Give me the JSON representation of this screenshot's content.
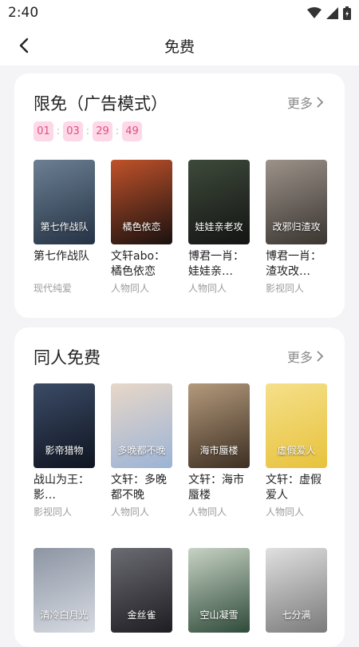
{
  "status": {
    "time": "2:40"
  },
  "header": {
    "title": "免费"
  },
  "section1": {
    "title": "限免（广告模式）",
    "more": "更多",
    "timer": [
      "01",
      "03",
      "29",
      "49"
    ],
    "books": [
      {
        "title": "第七作战队",
        "category": "现代纯爱",
        "cover_text": "第七作战队",
        "color1": "#243244",
        "color2": "#6c7f93"
      },
      {
        "title": "文轩abo：橘色依恋",
        "category": "人物同人",
        "cover_text": "橘色依恋",
        "color1": "#1a1110",
        "color2": "#c0522a"
      },
      {
        "title": "博君一肖：娃娃亲…",
        "category": "人物同人",
        "cover_text": "娃娃亲老攻",
        "color1": "#141414",
        "color2": "#3d4a3a"
      },
      {
        "title": "博君一肖：渣攻改…",
        "category": "影视同人",
        "cover_text": "改邪归渣攻",
        "color1": "#3a3530",
        "color2": "#9c928a"
      }
    ]
  },
  "section2": {
    "title": "同人免费",
    "more": "更多",
    "books_row1": [
      {
        "title": "战山为王：影…",
        "category": "影视同人",
        "cover_text": "影帝猎物",
        "color1": "#0f1420",
        "color2": "#3b4b66"
      },
      {
        "title": "文轩：多晚都不晚",
        "category": "人物同人",
        "cover_text": "多晚都不晚",
        "color1": "#9bb3d6",
        "color2": "#e8d7c8"
      },
      {
        "title": "文轩：海市蜃楼",
        "category": "人物同人",
        "cover_text": "海市蜃楼",
        "color1": "#3d2f22",
        "color2": "#b49a7c"
      },
      {
        "title": "文轩：虚假爱人",
        "category": "人物同人",
        "cover_text": "虚假爱人",
        "color1": "#e8c23c",
        "color2": "#f5e08a"
      }
    ],
    "books_row2": [
      {
        "cover_text": "清冷白月光",
        "color1": "#d7dbe2",
        "color2": "#8d95a3"
      },
      {
        "cover_text": "金丝雀",
        "color1": "#1d1d22",
        "color2": "#6b6b72"
      },
      {
        "cover_text": "空山凝雪",
        "color1": "#2f4a3a",
        "color2": "#c7d3c4"
      },
      {
        "cover_text": "七分满",
        "color1": "#7a7a7a",
        "color2": "#e0e0e0"
      }
    ]
  }
}
